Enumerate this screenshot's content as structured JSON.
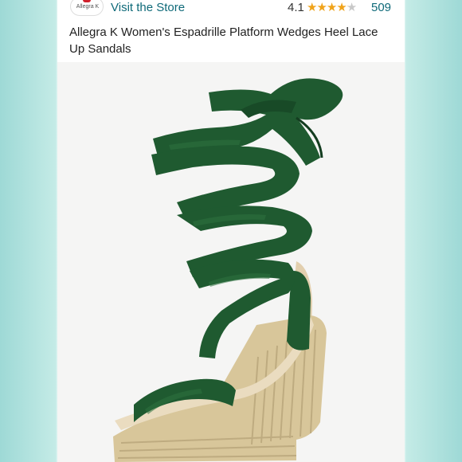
{
  "store": {
    "brand_logo_text": "Allegra K",
    "visit_label": "Visit the Store",
    "rating": "4.1",
    "rating_value": 4.1,
    "review_count": "509"
  },
  "product": {
    "title": "Allegra K Women's Espadrille Platform Wedges Heel Lace Up Sandals",
    "image_icon": "green-lace-up-espadrille-wedge-sandal"
  },
  "colors": {
    "link": "#0f6a79",
    "star": "#f0a31a",
    "sandal_green": "#1f5a30",
    "jute": "#d8c69a",
    "side_accent": "#9ed9d6"
  }
}
